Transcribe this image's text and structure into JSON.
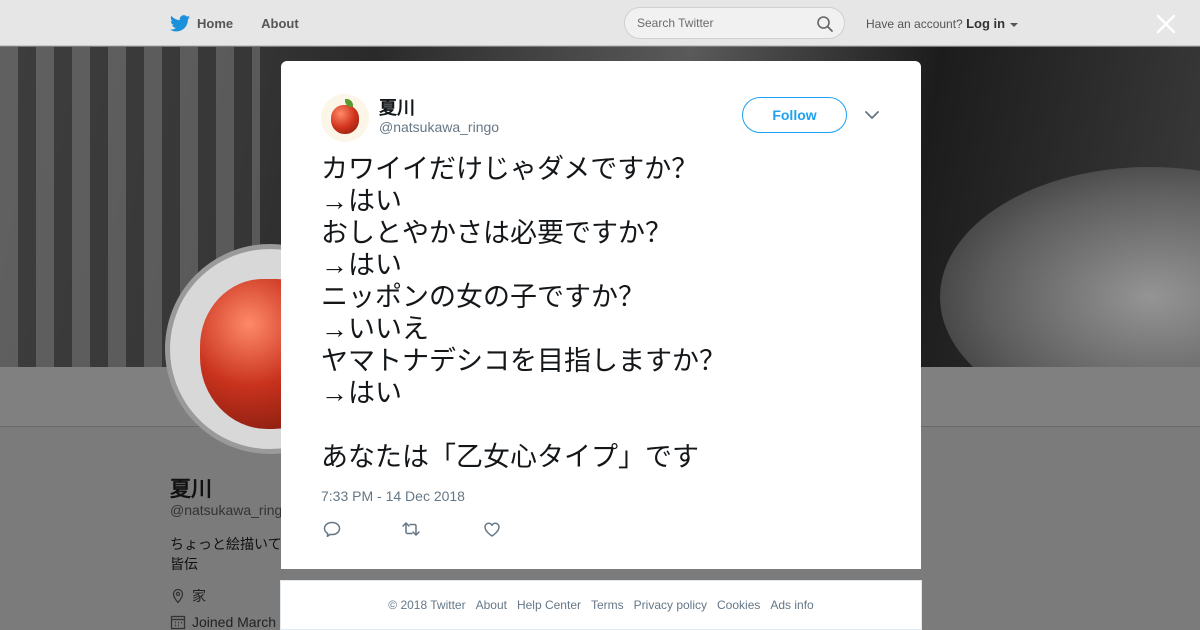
{
  "topnav": {
    "home_label": "Home",
    "about_label": "About",
    "search_placeholder": "Search Twitter",
    "account_prompt": "Have an account?",
    "login_label": "Log in"
  },
  "profile": {
    "name": "夏川",
    "handle": "@natsukawa_ringo",
    "bio": "ちょっと絵描いて\n皆伝",
    "location": "家",
    "joined": "Joined March"
  },
  "tweet": {
    "author_name": "夏川",
    "author_handle": "@natsukawa_ringo",
    "follow_label": "Follow",
    "lines": [
      "カワイイだけじゃダメですか？",
      "→はい",
      "おしとやかさは必要ですか？",
      "→はい",
      "ニッポンの女の子ですか？",
      "→いいえ",
      "ヤマトナデシコを目指しますか？",
      "→はい",
      "",
      "あなたは「乙女心タイプ」です"
    ],
    "timestamp": "7:33 PM - 14 Dec 2018"
  },
  "footer": {
    "copyright": "© 2018 Twitter",
    "links": [
      "About",
      "Help Center",
      "Terms",
      "Privacy policy",
      "Cookies",
      "Ads info"
    ]
  },
  "colors": {
    "accent": "#1da1f2",
    "muted_text": "#657786",
    "overlay": "#7b7b7b"
  },
  "icons": [
    "twitter-bird-icon",
    "search-icon",
    "close-icon",
    "chevron-down-icon",
    "reply-icon",
    "retweet-icon",
    "like-icon",
    "location-pin-icon",
    "calendar-icon"
  ]
}
